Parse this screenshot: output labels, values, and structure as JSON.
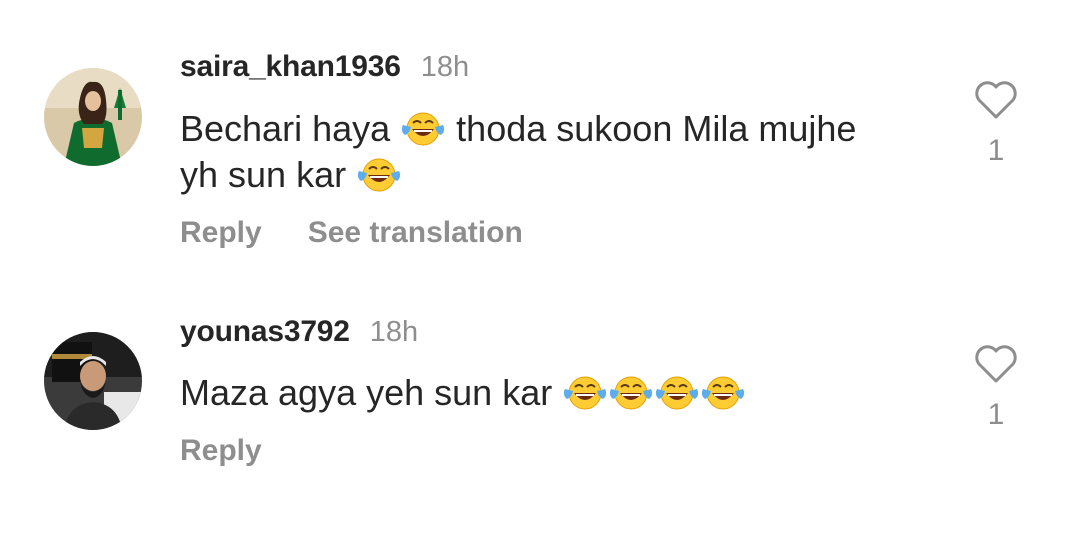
{
  "comments": [
    {
      "username": "saira_khan1936",
      "time": "18h",
      "text_line1": "Bechari haya",
      "text_line1b": "thoda sukoon Mila mujhe",
      "text_line2": "yh sun kar",
      "reply_label": "Reply",
      "translate_label": "See translation",
      "like_count": "1",
      "avatar_icon": "avatar-woman-green-dress",
      "emoji_icon": "face-with-tears-of-joy-icon"
    },
    {
      "username": "younas3792",
      "time": "18h",
      "text": "Maza agya yeh sun kar",
      "reply_label": "Reply",
      "like_count": "1",
      "avatar_icon": "avatar-man-kaaba",
      "emoji_icon": "face-with-tears-of-joy-icon"
    }
  ],
  "colors": {
    "text": "#262626",
    "secondary": "#8e8e8e",
    "emoji_yellow": "#FFCC33",
    "emoji_tear": "#5DADEC"
  }
}
